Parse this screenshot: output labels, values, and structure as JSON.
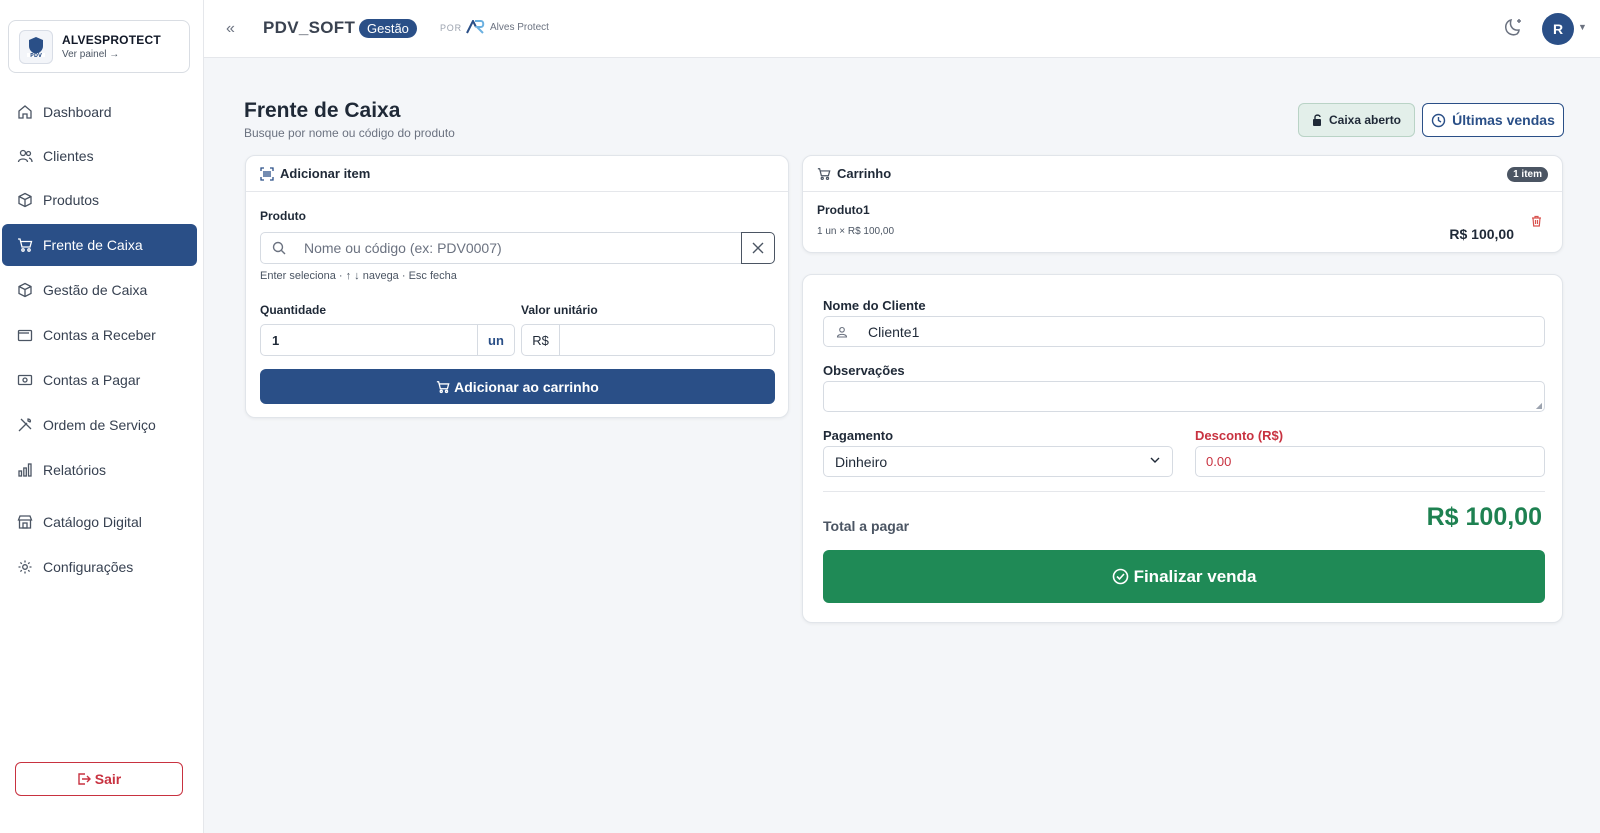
{
  "brand": {
    "name": "ALVESPROTECT",
    "sub": "Ver painel →",
    "logo_text": "PDV"
  },
  "sidebar": {
    "items": [
      {
        "label": "Dashboard",
        "icon": "home-icon"
      },
      {
        "label": "Clientes",
        "icon": "users-icon"
      },
      {
        "label": "Produtos",
        "icon": "box-icon"
      },
      {
        "label": "Frente de Caixa",
        "icon": "cart-icon",
        "active": true
      },
      {
        "label": "Gestão de Caixa",
        "icon": "box-icon"
      },
      {
        "label": "Contas a Receber",
        "icon": "wallet-icon"
      },
      {
        "label": "Contas a Pagar",
        "icon": "money-icon"
      },
      {
        "label": "Ordem de Serviço",
        "icon": "tools-icon"
      },
      {
        "label": "Relatórios",
        "icon": "bar-chart-icon"
      },
      {
        "label": "Catálogo Digital",
        "icon": "store-icon"
      },
      {
        "label": "Configurações",
        "icon": "gear-icon"
      }
    ],
    "logout": "Sair"
  },
  "header": {
    "app_title": "PDV_SOFT",
    "badge": "Gestão",
    "by": "POR",
    "company": "Alves Protect",
    "avatar": "R"
  },
  "page": {
    "title": "Frente de Caixa",
    "subtitle": "Busque por nome ou código do produto",
    "btn_caixa": "Caixa aberto",
    "btn_ultimas": "Últimas vendas"
  },
  "add_item": {
    "title": "Adicionar item",
    "product_label": "Produto",
    "product_placeholder": "Nome ou código (ex: PDV0007)",
    "hint": "Enter seleciona · ↑ ↓ navega · Esc fecha",
    "qty_label": "Quantidade",
    "qty_value": "1",
    "qty_unit": "un",
    "price_label": "Valor unitário",
    "price_prefix": "R$",
    "price_value": "",
    "add_button": "Adicionar ao carrinho"
  },
  "cart": {
    "title": "Carrinho",
    "count": "1 item",
    "items": [
      {
        "name": "Produto1",
        "detail": "1 un × R$ 100,00",
        "total": "R$ 100,00"
      }
    ]
  },
  "checkout": {
    "client_label": "Nome do Cliente",
    "client_value": "Cliente1",
    "obs_label": "Observações",
    "obs_value": "",
    "payment_label": "Pagamento",
    "payment_value": "Dinheiro",
    "discount_label": "Desconto (R$)",
    "discount_value": "0.00",
    "total_label": "Total a pagar",
    "total_value": "R$ 100,00",
    "finalize_button": "Finalizar venda"
  },
  "colors": {
    "primary": "#2a4f87",
    "success": "#1f8a56",
    "danger": "#c83240"
  }
}
